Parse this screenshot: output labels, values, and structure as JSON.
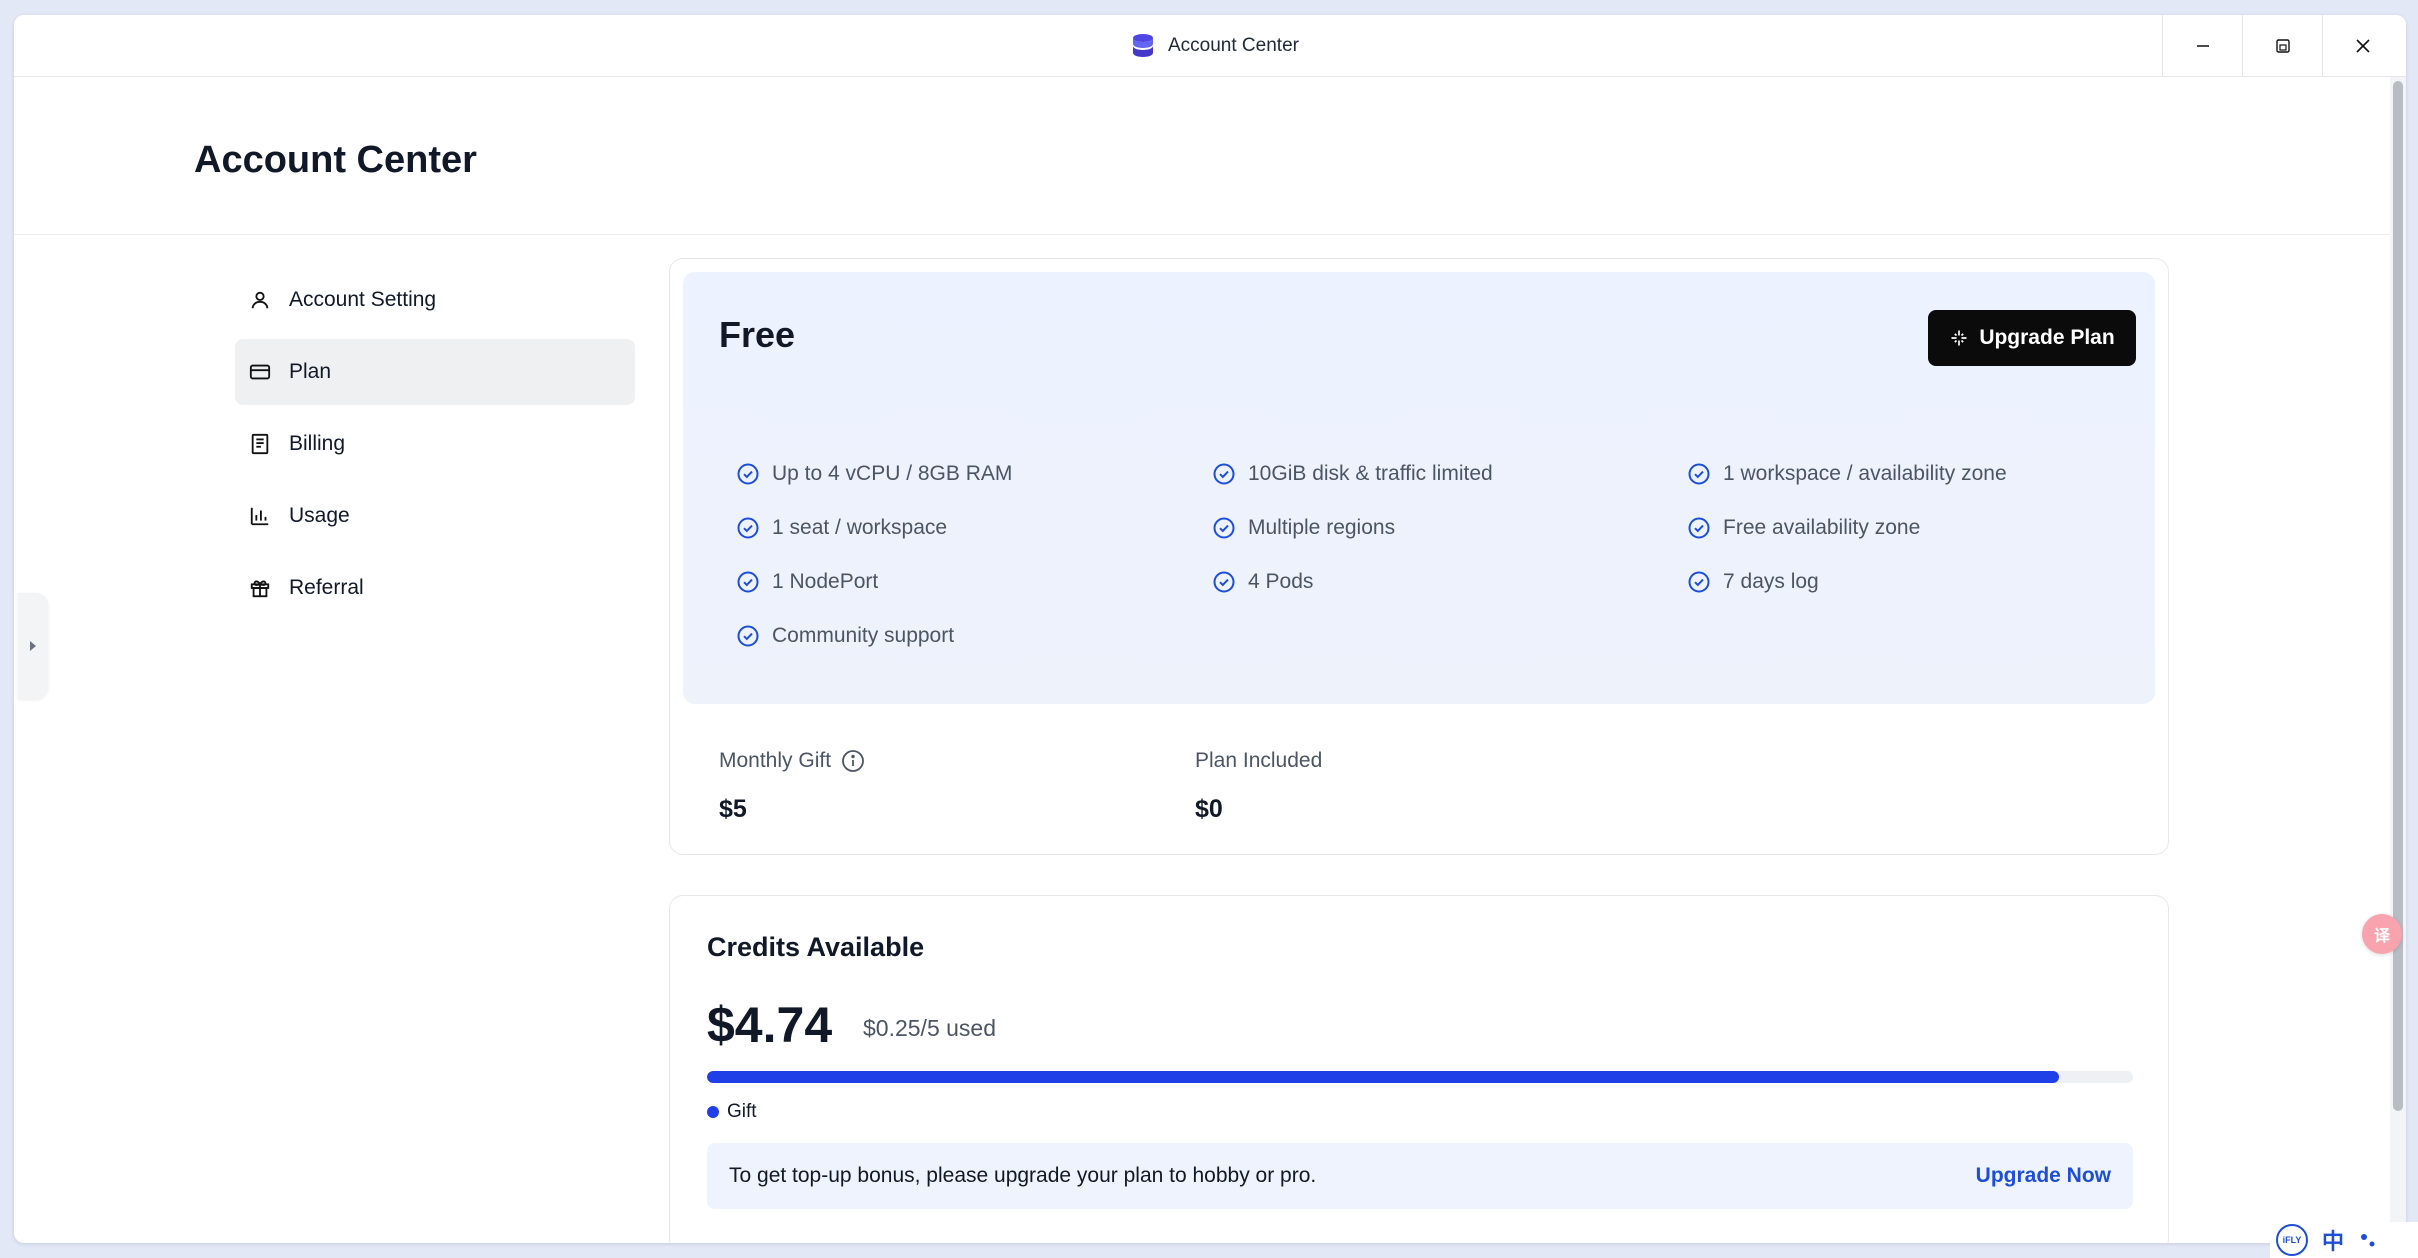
{
  "window": {
    "title": "Account Center"
  },
  "page": {
    "title": "Account Center"
  },
  "sidebar": {
    "items": [
      {
        "label": "Account Setting",
        "icon": "user-icon",
        "active": false
      },
      {
        "label": "Plan",
        "icon": "credit-card-icon",
        "active": true
      },
      {
        "label": "Billing",
        "icon": "receipt-icon",
        "active": false
      },
      {
        "label": "Usage",
        "icon": "bar-chart-icon",
        "active": false
      },
      {
        "label": "Referral",
        "icon": "gift-icon",
        "active": false
      }
    ]
  },
  "plan": {
    "name": "Free",
    "upgrade_label": "Upgrade Plan",
    "features": [
      "Up to 4 vCPU / 8GB RAM",
      "10GiB disk & traffic limited",
      "1 workspace / availability zone",
      "1 seat / workspace",
      "Multiple regions",
      "Free availability zone",
      "1 NodePort",
      "4 Pods",
      "7 days log",
      "Community support"
    ],
    "monthly_gift_label": "Monthly Gift",
    "monthly_gift_value": "$5",
    "plan_included_label": "Plan Included",
    "plan_included_value": "$0"
  },
  "credits": {
    "title": "Credits Available",
    "amount": "$4.74",
    "used": "$0.25/5 used",
    "remaining_fraction": 0.948,
    "legend_label": "Gift",
    "banner_text": "To get top-up bonus, please upgrade your plan to hobby or pro.",
    "banner_link": "Upgrade Now"
  },
  "colors": {
    "accent": "#1e40e6",
    "check": "#1d4ed8",
    "button_bg": "#0b0b0c"
  },
  "ime": {
    "label": "中"
  }
}
